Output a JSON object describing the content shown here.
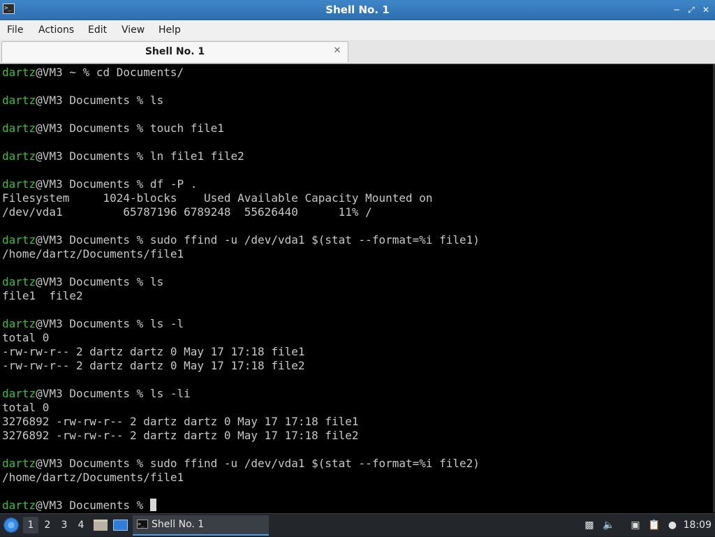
{
  "window": {
    "title": "Shell No. 1",
    "controls": {
      "minimize": "−",
      "maximize": "⤢",
      "close": "✕"
    }
  },
  "menu": {
    "items": [
      "File",
      "Actions",
      "Edit",
      "View",
      "Help"
    ]
  },
  "tabs": [
    {
      "label": "Shell No. 1",
      "close": "✕"
    }
  ],
  "terminal": {
    "prompt_user": "dartz",
    "lines": [
      {
        "user": "dartz",
        "rest": "@VM3 ~ % cd Documents/"
      },
      {
        "text": ""
      },
      {
        "user": "dartz",
        "rest": "@VM3 Documents % ls"
      },
      {
        "text": ""
      },
      {
        "user": "dartz",
        "rest": "@VM3 Documents % touch file1"
      },
      {
        "text": ""
      },
      {
        "user": "dartz",
        "rest": "@VM3 Documents % ln file1 file2"
      },
      {
        "text": ""
      },
      {
        "user": "dartz",
        "rest": "@VM3 Documents % df -P ."
      },
      {
        "text": "Filesystem     1024-blocks    Used Available Capacity Mounted on"
      },
      {
        "text": "/dev/vda1         65787196 6789248  55626440      11% /"
      },
      {
        "text": ""
      },
      {
        "user": "dartz",
        "rest": "@VM3 Documents % sudo ffind -u /dev/vda1 $(stat --format=%i file1)"
      },
      {
        "text": "/home/dartz/Documents/file1"
      },
      {
        "text": ""
      },
      {
        "user": "dartz",
        "rest": "@VM3 Documents % ls"
      },
      {
        "text": "file1  file2"
      },
      {
        "text": ""
      },
      {
        "user": "dartz",
        "rest": "@VM3 Documents % ls -l"
      },
      {
        "text": "total 0"
      },
      {
        "text": "-rw-rw-r-- 2 dartz dartz 0 May 17 17:18 file1"
      },
      {
        "text": "-rw-rw-r-- 2 dartz dartz 0 May 17 17:18 file2"
      },
      {
        "text": ""
      },
      {
        "user": "dartz",
        "rest": "@VM3 Documents % ls -li"
      },
      {
        "text": "total 0"
      },
      {
        "text": "3276892 -rw-rw-r-- 2 dartz dartz 0 May 17 17:18 file1"
      },
      {
        "text": "3276892 -rw-rw-r-- 2 dartz dartz 0 May 17 17:18 file2"
      },
      {
        "text": ""
      },
      {
        "user": "dartz",
        "rest": "@VM3 Documents % sudo ffind -u /dev/vda1 $(stat --format=%i file2)"
      },
      {
        "text": "/home/dartz/Documents/file1"
      },
      {
        "text": ""
      },
      {
        "user": "dartz",
        "rest": "@VM3 Documents % ",
        "cursor": true
      }
    ],
    "colors": {
      "background": "#000000",
      "text": "#c8c8c8",
      "prompt_user": "#34c23a"
    }
  },
  "taskbar": {
    "start_icon": "start-menu-icon",
    "workspaces": [
      "1",
      "2",
      "3",
      "4"
    ],
    "active_workspace": "1",
    "launchers": [
      "file-manager-icon",
      "show-desktop-icon"
    ],
    "task": {
      "label": "Shell No. 1",
      "icon": "terminal-icon"
    },
    "tray": [
      "trash-icon",
      "volume-icon",
      "network-icon",
      "clipboard-icon",
      "notification-icon"
    ],
    "clock": "18:09"
  }
}
